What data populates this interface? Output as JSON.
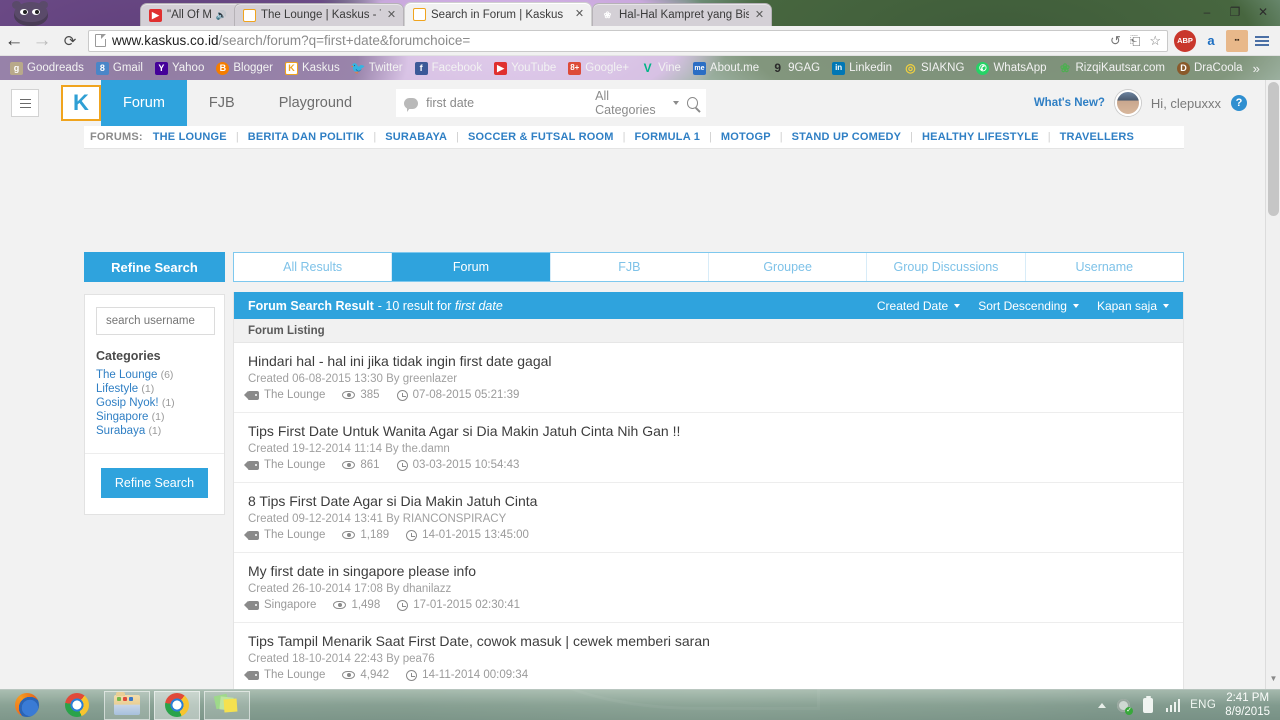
{
  "window": {
    "minimize": "–",
    "maximize": "❐",
    "close": "✕"
  },
  "browser": {
    "tabs": [
      {
        "label": "\"All Of Me\" - John Legend",
        "favicon": "youtube-icon",
        "muted": true,
        "active": false
      },
      {
        "label": "The Lounge | Kaskus - The La",
        "favicon": "kaskus-icon",
        "muted": false,
        "active": false
      },
      {
        "label": "Search in Forum | Kaskus ",
        "favicon": "kaskus-icon",
        "muted": false,
        "active": true
      },
      {
        "label": "Hal-Hal Kampret yang Bis",
        "favicon": "leaf-icon",
        "muted": false,
        "active": false
      }
    ],
    "nav": {
      "back": "←",
      "forward": "→",
      "reload": "⟳"
    },
    "url": {
      "host": "www.kaskus.co.id",
      "path": "/search/forum?q=first+date&forumchoice="
    },
    "omnibox_right": {
      "history": "↺",
      "translate": "⎗",
      "bookmark": "☆"
    },
    "extensions": [
      {
        "name": "adblock-plus-icon",
        "label": "ABP"
      },
      {
        "name": "amazon-assistant-icon",
        "label": "a"
      },
      {
        "name": "box-extension-icon",
        "label": ""
      }
    ],
    "bookmarks": [
      {
        "label": "Goodreads",
        "icon": "g",
        "color": "#b8a98a"
      },
      {
        "label": "Gmail",
        "icon": "8",
        "color": "#4a86c8"
      },
      {
        "label": "Yahoo",
        "icon": "Y",
        "color": "#440099"
      },
      {
        "label": "Blogger",
        "icon": "B",
        "color": "#f57d00"
      },
      {
        "label": "Kaskus",
        "icon": "K",
        "color": "#f0a41e"
      },
      {
        "label": "Twitter",
        "icon": "t",
        "color": "#55acee"
      },
      {
        "label": "Facebook",
        "icon": "f",
        "color": "#3b5998"
      },
      {
        "label": "YouTube",
        "icon": "▶",
        "color": "#e02f2f"
      },
      {
        "label": "Google+",
        "icon": "8+",
        "color": "#dd4b39"
      },
      {
        "label": "Vine",
        "icon": "V",
        "color": "#00b488"
      },
      {
        "label": "About.me",
        "icon": "me",
        "color": "#2b6ec4"
      },
      {
        "label": "9GAG",
        "icon": "9",
        "color": "#2b2b2b"
      },
      {
        "label": "Linkedin",
        "icon": "in",
        "color": "#0077b5"
      },
      {
        "label": "SIAKNG",
        "icon": "◎",
        "color": "#f0d040"
      },
      {
        "label": "WhatsApp",
        "icon": "✆",
        "color": "#25d366"
      },
      {
        "label": "RizqiKautsar.com",
        "icon": "✿",
        "color": "#4caf50"
      },
      {
        "label": "DraCoola",
        "icon": "D",
        "color": "#8a5a2b"
      }
    ],
    "bookmarks_overflow": "»"
  },
  "site": {
    "menu_icon": "hamburger-icon",
    "logo_text": "K",
    "nav": [
      {
        "label": "Forum",
        "active": true
      },
      {
        "label": "FJB",
        "active": false
      },
      {
        "label": "Playground",
        "active": false
      }
    ],
    "search": {
      "value": "first date",
      "placeholder": "first date",
      "category_label": "All Categories"
    },
    "whats_new": "What's New?",
    "greeting": "Hi, clepuxxx",
    "help": "?"
  },
  "forums_strip": {
    "label": "FORUMS:",
    "links": [
      "THE LOUNGE",
      "BERITA DAN POLITIK",
      "SURABAYA",
      "SOCCER & FUTSAL ROOM",
      "FORMULA 1",
      "MOTOGP",
      "STAND UP COMEDY",
      "HEALTHY LIFESTYLE",
      "TRAVELLERS"
    ],
    "separator": "|"
  },
  "refine_button": "Refine Search",
  "result_tabs": [
    {
      "label": "All Results",
      "active": false
    },
    {
      "label": "Forum",
      "active": true
    },
    {
      "label": "FJB",
      "active": false
    },
    {
      "label": "Groupee",
      "active": false
    },
    {
      "label": "Group Discussions",
      "active": false
    },
    {
      "label": "Username",
      "active": false
    }
  ],
  "sidebar": {
    "username_placeholder": "search username",
    "username_value": "",
    "categories_title": "Categories",
    "categories": [
      {
        "label": "The Lounge",
        "count": "(6)"
      },
      {
        "label": "Lifestyle",
        "count": "(1)"
      },
      {
        "label": "Gosip Nyok!",
        "count": "(1)"
      },
      {
        "label": "Singapore",
        "count": "(1)"
      },
      {
        "label": "Surabaya",
        "count": "(1)"
      }
    ],
    "refine_button": "Refine Search"
  },
  "results": {
    "header_title": "Forum Search Result",
    "header_sub_prefix": "- 10 result for ",
    "header_query": "first date",
    "sorts": [
      {
        "label": "Created Date"
      },
      {
        "label": "Sort Descending"
      },
      {
        "label": "Kapan saja"
      }
    ],
    "listing_header": "Forum Listing",
    "items": [
      {
        "title": "Hindari hal - hal ini jika tidak ingin first date gagal",
        "meta": "Created 06-08-2015 13:30 By greenlazer",
        "forum": "The Lounge",
        "views": "385",
        "last": "07-08-2015 05:21:39"
      },
      {
        "title": "Tips First Date Untuk Wanita Agar si Dia Makin Jatuh Cinta Nih Gan !!",
        "meta": "Created 19-12-2014 11:14 By the.damn",
        "forum": "The Lounge",
        "views": "861",
        "last": "03-03-2015 10:54:43"
      },
      {
        "title": "8 Tips First Date Agar si Dia Makin Jatuh Cinta",
        "meta": "Created 09-12-2014 13:41 By RIANCONSPIRACY",
        "forum": "The Lounge",
        "views": "1,189",
        "last": "14-01-2015 13:45:00"
      },
      {
        "title": "My first date in singapore please info",
        "meta": "Created 26-10-2014 17:08 By dhanilazz",
        "forum": "Singapore",
        "views": "1,498",
        "last": "17-01-2015 02:30:41"
      },
      {
        "title": "Tips Tampil Menarik Saat First Date, cowok masuk | cewek memberi saran",
        "meta": "Created 18-10-2014 22:43 By pea76",
        "forum": "The Lounge",
        "views": "4,942",
        "last": "14-11-2014 00:09:34"
      }
    ]
  },
  "taskbar": {
    "items": [
      {
        "name": "firefox-taskbar-icon",
        "boxed": false,
        "active": false
      },
      {
        "name": "chrome-taskbar-icon",
        "boxed": false,
        "active": false
      },
      {
        "name": "file-explorer-taskbar-icon",
        "boxed": true,
        "active": false
      },
      {
        "name": "chrome-window-taskbar-icon",
        "boxed": true,
        "active": true
      },
      {
        "name": "sticky-notes-taskbar-icon",
        "boxed": true,
        "active": false
      }
    ],
    "tray": {
      "show_hidden": "▲",
      "network": "network-icon",
      "battery": "battery-icon",
      "signal": "signal-icon",
      "language": "ENG",
      "time": "2:41 PM",
      "date": "8/9/2015"
    }
  },
  "colors": {
    "accent": "#2fa3dd",
    "link": "#2f7fc4",
    "logo_border": "#f0a41e",
    "page_bg": "#f2f2f2"
  }
}
